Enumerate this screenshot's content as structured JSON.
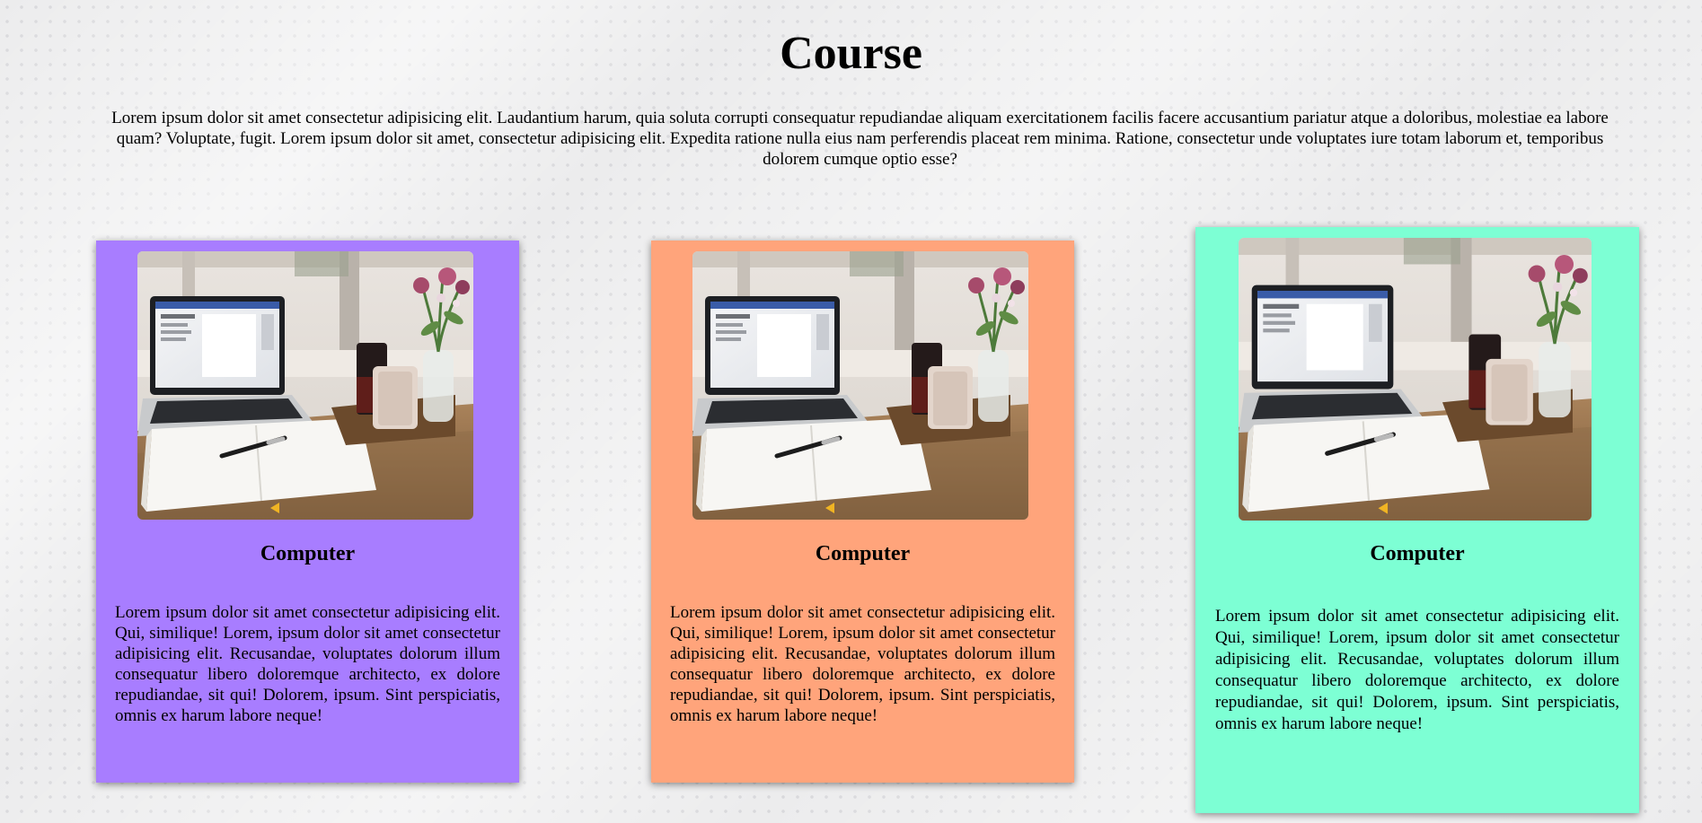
{
  "page": {
    "title": "Course",
    "intro": "Lorem ipsum dolor sit amet consectetur adipisicing elit. Laudantium harum, quia soluta corrupti consequatur repudiandae aliquam exercitationem facilis facere accusantium pariatur atque a doloribus, molestiae ea labore quam? Voluptate, fugit. Lorem ipsum dolor sit amet, consectetur adipisicing elit. Expedita ratione nulla eius nam perferendis placeat rem minima. Ratione, consectetur unde voluptates iure totam laborum et, temporibus dolorem cumque optio esse?"
  },
  "cards": [
    {
      "title": "Computer",
      "text": "Lorem ipsum dolor sit amet consectetur adipisicing elit. Qui, similique! Lorem, ipsum dolor sit amet consectetur adipisicing elit. Recusandae, voluptates dolorum illum consequatur libero doloremque architecto, ex dolore repudiandae, sit qui! Dolorem, ipsum. Sint perspiciatis, omnis ex harum labore neque!",
      "color": "#a87dff",
      "image": "laptop-desk-photo"
    },
    {
      "title": "Computer",
      "text": "Lorem ipsum dolor sit amet consectetur adipisicing elit. Qui, similique! Lorem, ipsum dolor sit amet consectetur adipisicing elit. Recusandae, voluptates dolorum illum consequatur libero doloremque architecto, ex dolore repudiandae, sit qui! Dolorem, ipsum. Sint perspiciatis, omnis ex harum labore neque!",
      "color": "#ffa47b",
      "image": "laptop-desk-photo"
    },
    {
      "title": "Computer",
      "text": "Lorem ipsum dolor sit amet consectetur adipisicing elit. Qui, similique! Lorem, ipsum dolor sit amet consectetur adipisicing elit. Recusandae, voluptates dolorum illum consequatur libero doloremque architecto, ex dolore repudiandae, sit qui! Dolorem, ipsum. Sint perspiciatis, omnis ex harum labore neque!",
      "color": "#7dffd4",
      "image": "laptop-desk-photo"
    }
  ]
}
